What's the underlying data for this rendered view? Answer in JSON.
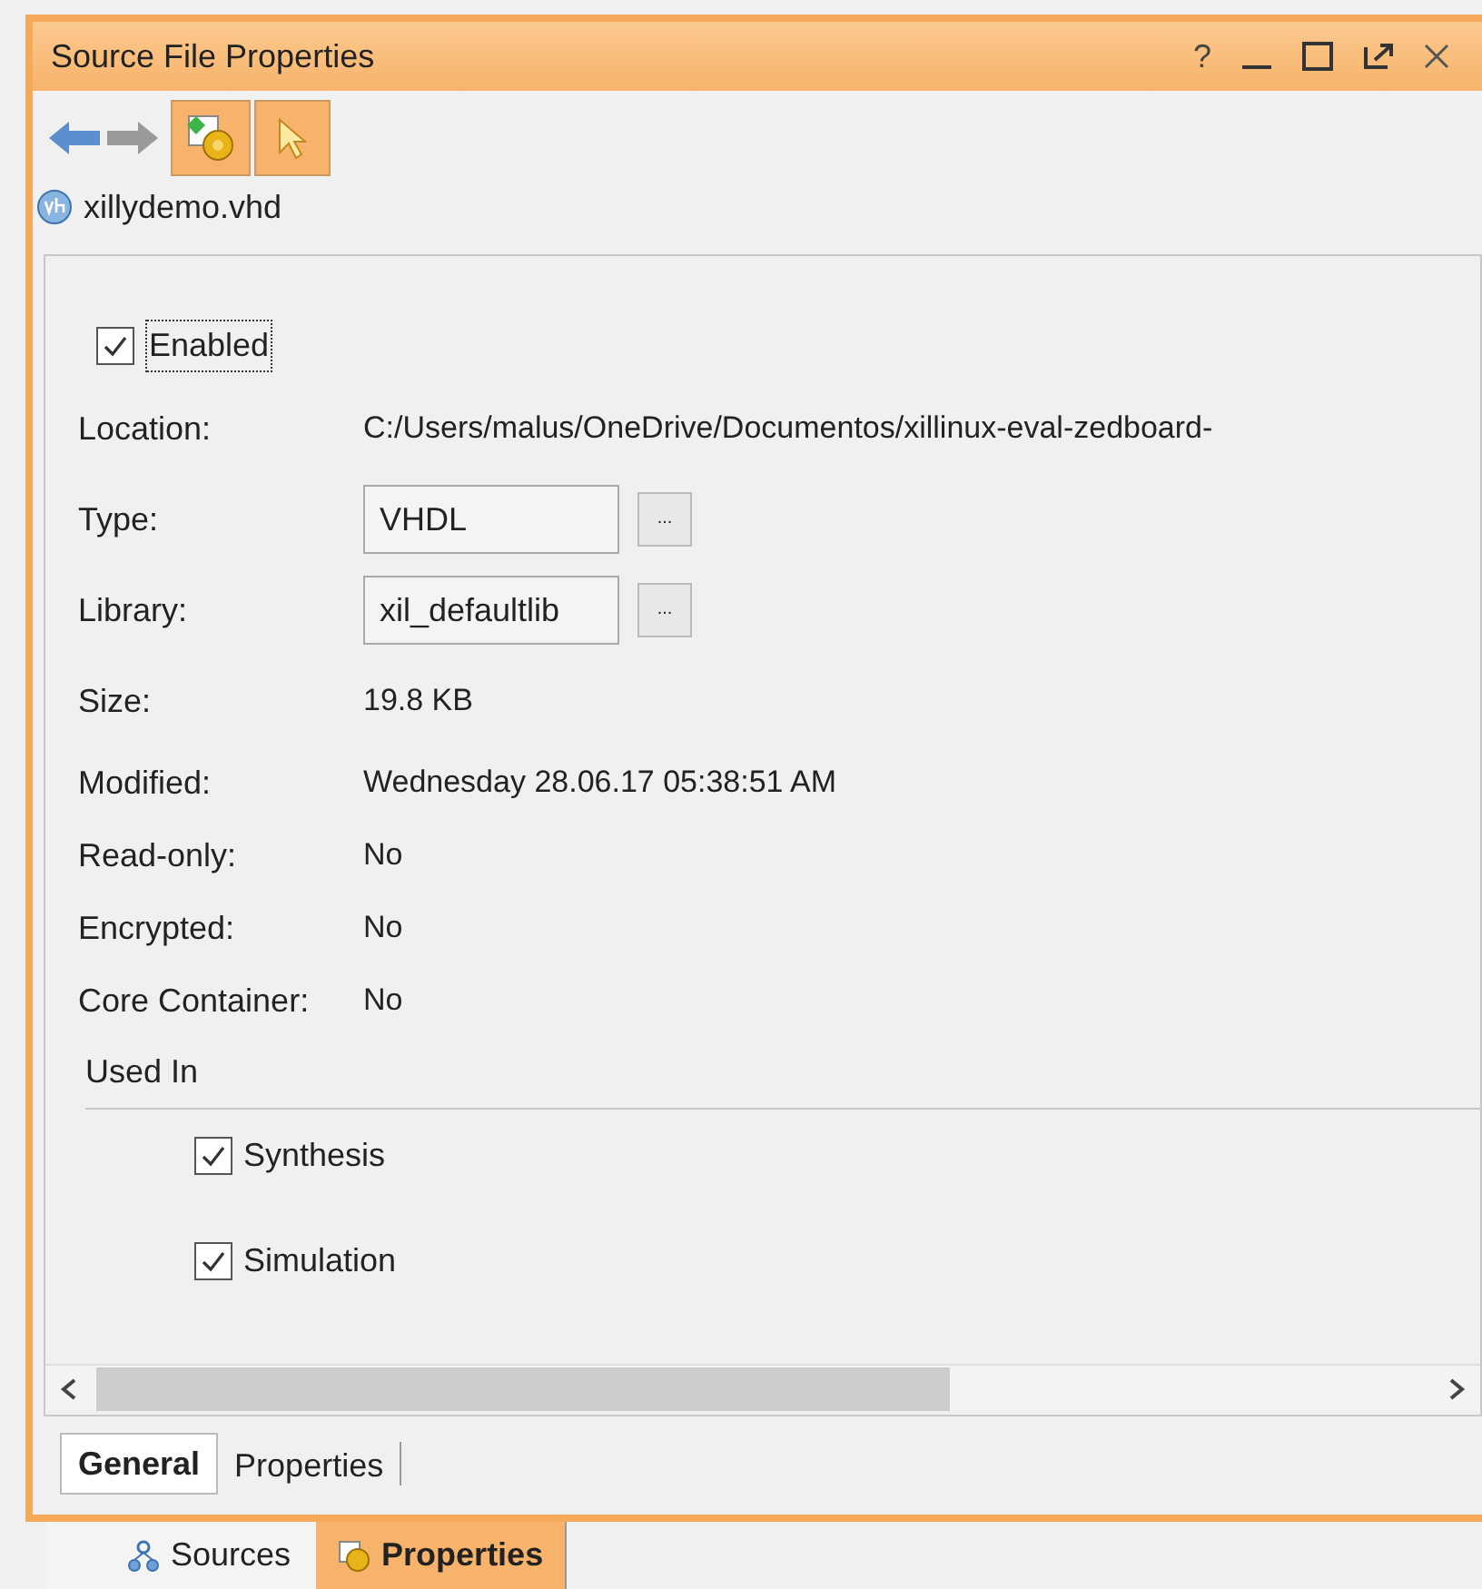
{
  "window": {
    "title": "Source File Properties",
    "help": "?"
  },
  "file": {
    "name": "xillydemo.vhd"
  },
  "enabled": {
    "label": "Enabled",
    "checked": true
  },
  "properties": [
    {
      "kind": "text",
      "label": "Location:",
      "value": "C:/Users/malus/OneDrive/Documentos/xillinux-eval-zedboard-"
    },
    {
      "kind": "field",
      "label": "Type:",
      "value": "VHDL",
      "button": "..."
    },
    {
      "kind": "field",
      "label": "Library:",
      "value": "xil_defaultlib",
      "button": "..."
    },
    {
      "kind": "text",
      "label": "Size:",
      "value": "19.8 KB"
    },
    {
      "kind": "text",
      "label": "Modified:",
      "value": "Wednesday 28.06.17 05:38:51 AM"
    },
    {
      "kind": "text",
      "label": "Read-only:",
      "value": "No"
    },
    {
      "kind": "text",
      "label": "Encrypted:",
      "value": "No"
    },
    {
      "kind": "text",
      "label": "Core Container:",
      "value": "No"
    }
  ],
  "used_in": {
    "title": "Used In",
    "items": [
      {
        "label": "Synthesis",
        "checked": true
      },
      {
        "label": "Simulation",
        "checked": true
      }
    ]
  },
  "subtabs": [
    {
      "label": "General",
      "selected": true
    },
    {
      "label": "Properties",
      "selected": false
    }
  ],
  "bottom_tabs": [
    {
      "label": "Sources",
      "selected": false
    },
    {
      "label": "Properties",
      "selected": true
    }
  ]
}
